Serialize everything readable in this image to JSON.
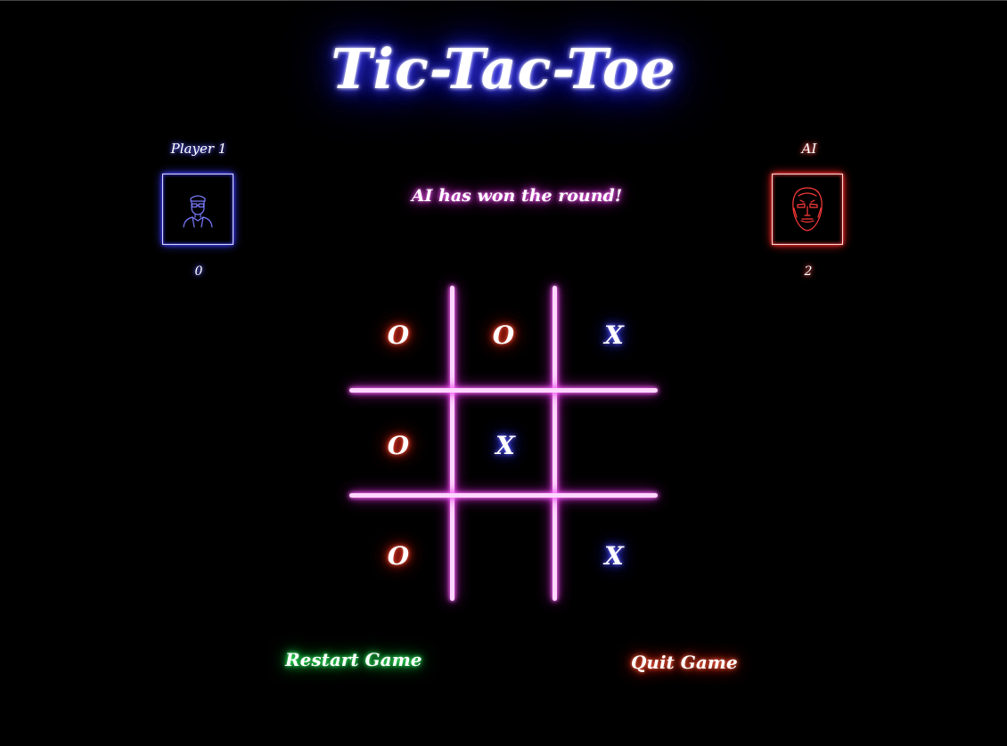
{
  "title": "Tic-Tac-Toe",
  "player": {
    "label": "Player 1",
    "score": "0",
    "avatar_icon": "person-outline-icon"
  },
  "ai": {
    "label": "AI",
    "score": "2",
    "avatar_icon": "robot-face-icon"
  },
  "status": "AI has won the round!",
  "board": [
    "O",
    "O",
    "X",
    "O",
    "X",
    "",
    "O",
    "",
    "X"
  ],
  "buttons": {
    "restart": "Restart Game",
    "quit": "Quit Game"
  },
  "colors": {
    "title_glow": "#3a3aff",
    "grid_glow": "#f040f0",
    "o_glow": "#ff3020",
    "x_glow": "#4040ff",
    "restart_glow": "#20e050",
    "quit_glow": "#ff3a20"
  }
}
